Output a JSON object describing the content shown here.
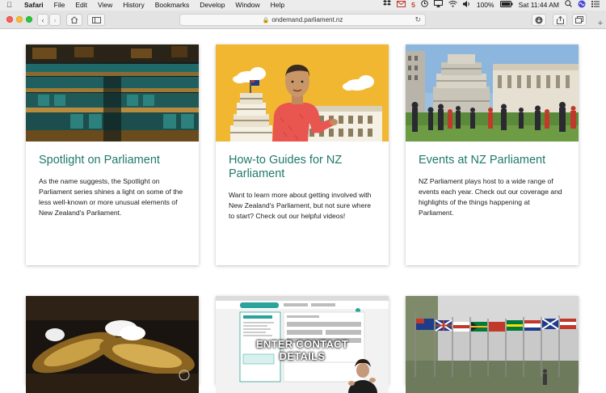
{
  "menubar": {
    "app": "Safari",
    "items": [
      "File",
      "Edit",
      "View",
      "History",
      "Bookmarks",
      "Develop",
      "Window",
      "Help"
    ],
    "mail_count": "5",
    "battery": "100%",
    "clock": "Sat 11:44 AM"
  },
  "toolbar": {
    "url": "ondemand.parliament.nz"
  },
  "cards": [
    {
      "title": "Spotlight on Parliament",
      "body": "As the name suggests, the Spotlight on Parliament series shines a light on some of the less well-known or more unusual elements of New Zealand's Parliament."
    },
    {
      "title": "How-to Guides for NZ Parliament",
      "body": "Want to learn more about getting involved with New Zealand's Parliament, but not sure where to start? Check out our helpful videos!"
    },
    {
      "title": "Events at NZ Parliament",
      "body": "NZ Parliament plays host to a wide range of events each year. Check out our coverage and highlights of the things happening at Parliament."
    },
    {
      "title": "",
      "body": ""
    },
    {
      "title": "",
      "body": "",
      "image_caption_line1": "ENTER CONTACT",
      "image_caption_line2": "DETAILS"
    },
    {
      "title": "",
      "body": ""
    }
  ],
  "colors": {
    "heading": "#1f7a6b",
    "illustration_bg": "#f2b731"
  }
}
